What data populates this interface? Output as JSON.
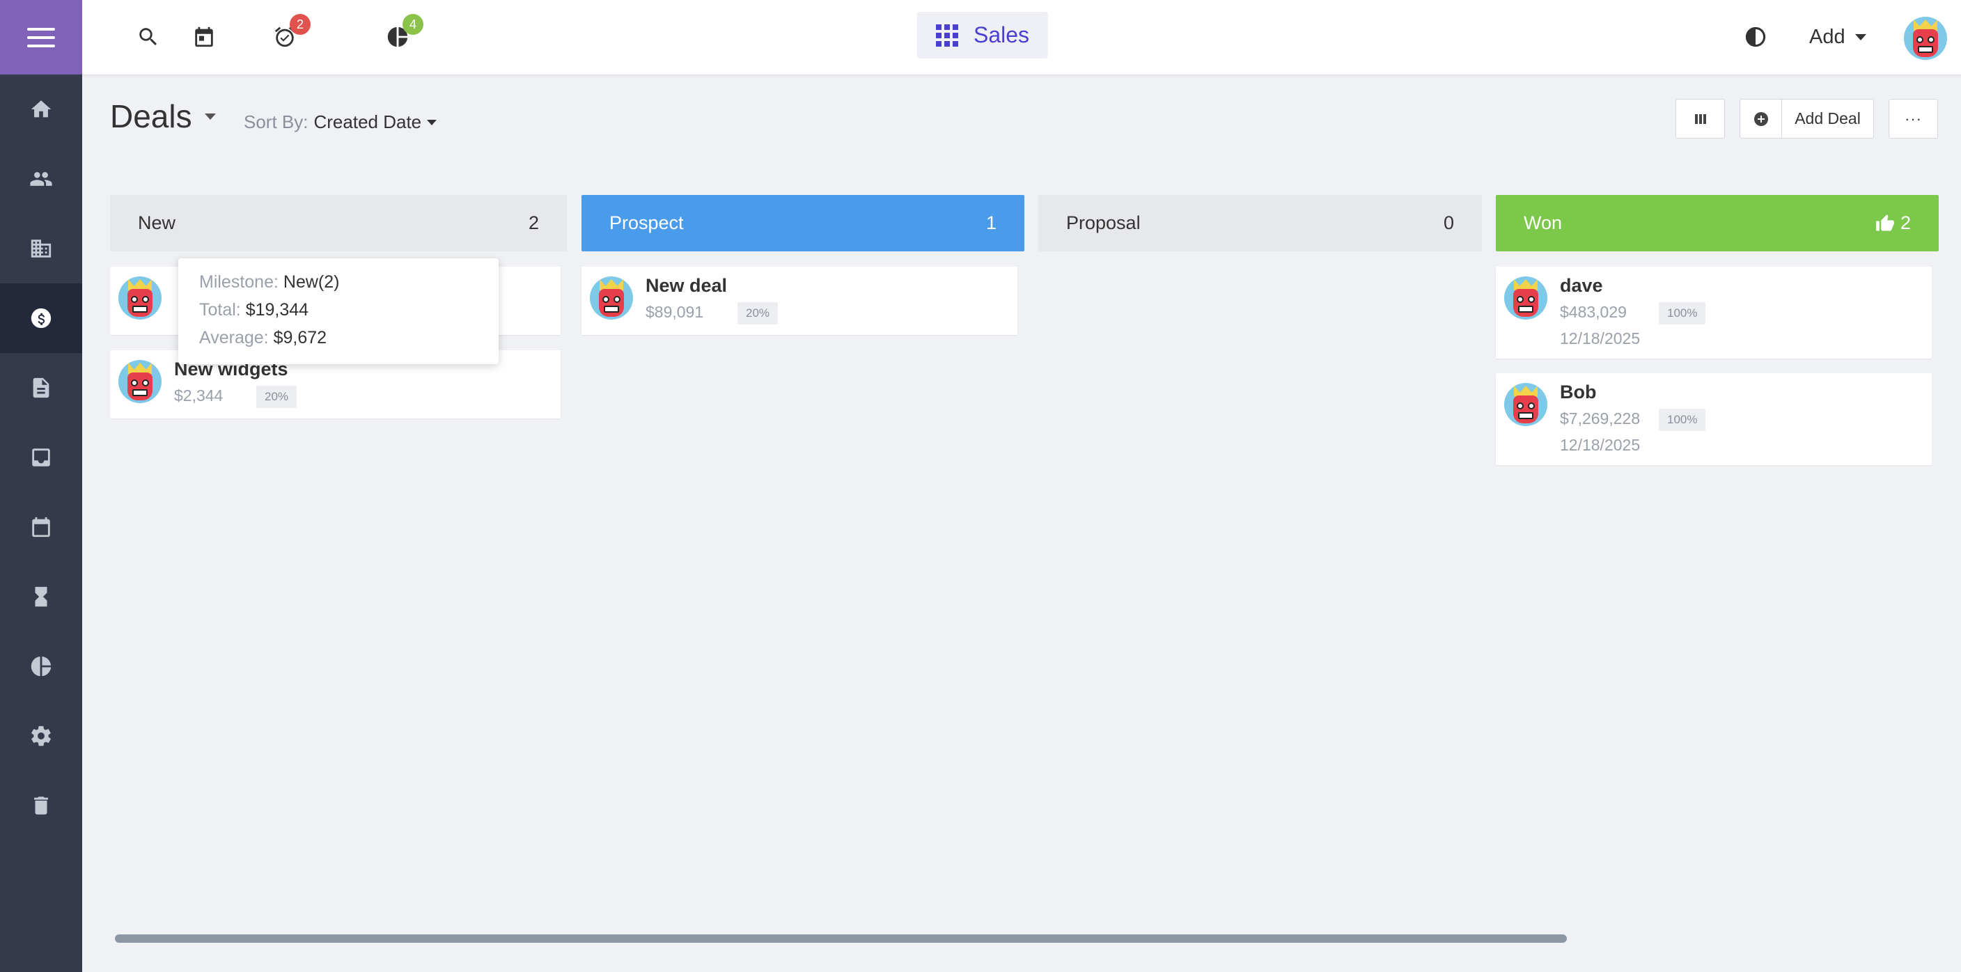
{
  "topbar": {
    "icons": [
      "search-icon",
      "calendar-icon",
      "alarm-clock-icon",
      "pie-chart-icon",
      "contrast-icon"
    ],
    "tasks_badge": "2",
    "reports_badge": "4",
    "app_name": "Sales",
    "add_label": "Add"
  },
  "sidebar": {
    "items": [
      "home-icon",
      "contacts-icon",
      "company-icon",
      "deals-icon",
      "documents-icon",
      "inbox-icon",
      "calendar-icon",
      "hourglass-icon",
      "reports-icon",
      "settings-icon",
      "trash-icon"
    ],
    "active": "deals-icon"
  },
  "header": {
    "title": "Deals",
    "sort_label": "Sort By:",
    "sort_value": "Created Date",
    "add_deal_label": "Add Deal",
    "more_label": "···"
  },
  "columns": [
    {
      "name": "New",
      "count": "2",
      "color": "#e6e8eb"
    },
    {
      "name": "Prospect",
      "count": "1",
      "color": "#4a9bec"
    },
    {
      "name": "Proposal",
      "count": "0",
      "color": "#e6e8eb"
    },
    {
      "name": "Won",
      "count": "2",
      "color": "#7cc84a"
    }
  ],
  "cards": {
    "new_1": {
      "title": "",
      "amount": ""
    },
    "new_2": {
      "title": "New widgets",
      "amount": "$2,344",
      "pct": "20%"
    },
    "prospect_1": {
      "title": "New deal",
      "amount": "$89,091",
      "pct": "20%"
    },
    "won_1": {
      "title": "dave",
      "amount": "$483,029",
      "pct": "100%",
      "date": "12/18/2025"
    },
    "won_2": {
      "title": "Bob",
      "amount": "$7,269,228",
      "pct": "100%",
      "date": "12/18/2025"
    }
  },
  "tooltip": {
    "milestone_label": "Milestone:",
    "milestone_value": "New(2)",
    "total_label": "Total:",
    "total_value": "$19,344",
    "average_label": "Average:",
    "average_value": "$9,672"
  }
}
